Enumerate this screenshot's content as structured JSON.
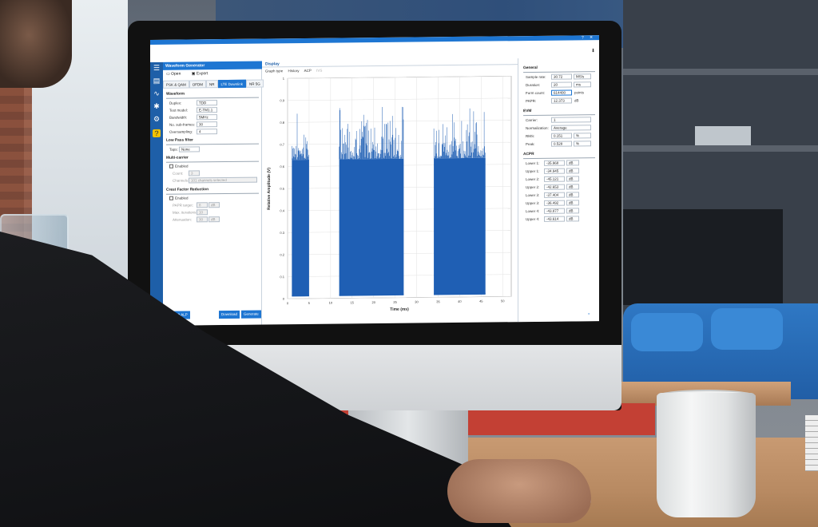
{
  "window": {
    "title": "Waveform Generator",
    "toolbar": {
      "open": "Open",
      "export": "Export"
    }
  },
  "generator": {
    "tabs": [
      "PSK & QAM",
      "OFDM",
      "NR",
      "LTE Downlink",
      "NR 5G"
    ],
    "waveform": {
      "title": "Waveform",
      "duplex_label": "Duplex:",
      "duplex_value": "TDD",
      "test_model_label": "Test model:",
      "test_model_value": "E-TM1.1",
      "bandwidth_label": "Bandwidth:",
      "bandwidth_value": "5MHz",
      "subframes_label": "No. sub-frames:",
      "subframes_value": "30",
      "oversampling_label": "Oversampling:",
      "oversampling_value": "4"
    },
    "low_pass": {
      "title": "Low Pass filter",
      "taps_label": "Taps:",
      "taps_value": "None"
    },
    "multi_carrier": {
      "title": "Multi-carrier",
      "enabled_label": "Enabled",
      "count_label": "Count:",
      "count_value": "3",
      "channels_label": "Channels:",
      "channels_value": "101 channels selected"
    },
    "cfr": {
      "title": "Crest Factor Reduction",
      "enabled_label": "Enabled",
      "papr_label": "PAPR target:",
      "papr_value": "8",
      "papr_unit": "dB",
      "max_iter_label": "Max. iterations:",
      "max_iter_value": "10",
      "attenuation_label": "Attenuation:",
      "attenuation_value": "30",
      "attenuation_unit": "dB"
    },
    "buttons": {
      "defaults": "Default ALP",
      "download": "Download",
      "generate": "Generate"
    }
  },
  "display": {
    "title": "Display",
    "tabs": [
      "Graph type",
      "History",
      "ACP",
      "IVS"
    ],
    "xlabel": "Time (ms)",
    "ylabel": "Relative Amplitude (V)"
  },
  "chart_data": {
    "type": "area",
    "title": "",
    "xlabel": "Time (ms)",
    "ylabel": "Relative Amplitude (V)",
    "yticks": [
      "1",
      "0.9",
      "0.8",
      "0.7",
      "0.6",
      "0.5",
      "0.4",
      "0.3",
      "0.2",
      "0.1",
      "0"
    ],
    "xticks": [
      "0",
      "5",
      "10",
      "15",
      "20",
      "25",
      "30",
      "35",
      "40",
      "45",
      "50"
    ],
    "ylim": [
      0,
      1
    ],
    "xlim": [
      0,
      52
    ],
    "grid": true,
    "bursts": [
      {
        "start": 1,
        "end": 5,
        "base_level": 0.63,
        "peak": 0.86
      },
      {
        "start": 12,
        "end": 27,
        "base_level": 0.63,
        "peak": 0.91
      },
      {
        "start": 34,
        "end": 46,
        "base_level": 0.63,
        "peak": 0.89
      }
    ],
    "color": "#1f5fb4"
  },
  "settings": {
    "general": {
      "title": "General",
      "sample_rate_label": "Sample rate:",
      "sample_rate_value": "30.72",
      "sample_rate_unit": "MS/s",
      "duration_label": "Duration:",
      "duration_value": "20",
      "duration_unit": "ms",
      "form_count_label": "Form count:",
      "form_count_value": "614400",
      "form_count_unit": "points",
      "papr_label": "PAPR:",
      "papr_value": "12.373",
      "papr_unit": "dB"
    },
    "evm": {
      "title": "EVM",
      "carrier_label": "Carrier:",
      "carrier_value": "1",
      "normalization_label": "Normalization:",
      "normalization_value": "Average",
      "rms_label": "RMS:",
      "rms_value": "0.151",
      "rms_unit": "%",
      "peak_label": "Peak:",
      "peak_value": "0.528",
      "peak_unit": "%"
    },
    "acpr": {
      "title": "ACPR",
      "rows": [
        {
          "label": "Lower 1:",
          "value": "-35.968",
          "unit": "dB"
        },
        {
          "label": "Upper 1:",
          "value": "-34.945",
          "unit": "dB"
        },
        {
          "label": "Lower 2:",
          "value": "-45.121",
          "unit": "dB"
        },
        {
          "label": "Upper 2:",
          "value": "-42.653",
          "unit": "dB"
        },
        {
          "label": "Lower 3:",
          "value": "-37.404",
          "unit": "dB"
        },
        {
          "label": "Upper 3:",
          "value": "-36.492",
          "unit": "dB"
        },
        {
          "label": "Lower 4:",
          "value": "-43.877",
          "unit": "dB"
        },
        {
          "label": "Upper 4:",
          "value": "-43.614",
          "unit": "dB"
        }
      ]
    }
  }
}
